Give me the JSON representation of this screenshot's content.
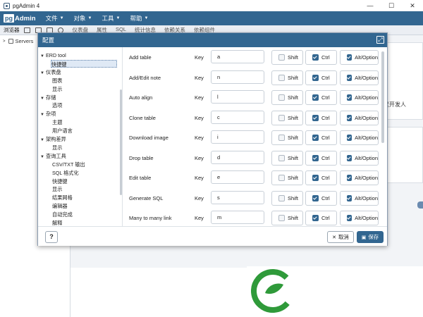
{
  "window": {
    "title": "pgAdmin 4",
    "controls": [
      "—",
      "☐",
      "✕"
    ]
  },
  "menubar": {
    "brand_pg": "pg",
    "brand_admin": "Admin",
    "items": [
      "文件",
      "对象",
      "工具",
      "帮助"
    ]
  },
  "toolbar": {
    "browser_label": "浏览器",
    "tabs": [
      "仪表盘",
      "属性",
      "SQL",
      "统计信息",
      "依赖关系",
      "依赖组件"
    ]
  },
  "tree_bg": {
    "servers_label": "Servers"
  },
  "background": {
    "partial_text": "满足开发人"
  },
  "dialog": {
    "title": "配置",
    "tree": [
      {
        "label": "ERD tool",
        "level": 0,
        "expanded": true
      },
      {
        "label": "快捷键",
        "level": 1,
        "selected": true
      },
      {
        "label": "仪表盘",
        "level": 0,
        "expanded": true
      },
      {
        "label": "图表",
        "level": 1
      },
      {
        "label": "显示",
        "level": 1
      },
      {
        "label": "存储",
        "level": 0,
        "expanded": true
      },
      {
        "label": "选项",
        "level": 1
      },
      {
        "label": "杂项",
        "level": 0,
        "expanded": true
      },
      {
        "label": "主题",
        "level": 1
      },
      {
        "label": "用户语言",
        "level": 1
      },
      {
        "label": "架构差异",
        "level": 0,
        "expanded": true
      },
      {
        "label": "显示",
        "level": 1
      },
      {
        "label": "查询工具",
        "level": 0,
        "expanded": true
      },
      {
        "label": "CSV/TXT 输出",
        "level": 1
      },
      {
        "label": "SQL 格式化",
        "level": 1
      },
      {
        "label": "快捷键",
        "level": 1
      },
      {
        "label": "显示",
        "level": 1
      },
      {
        "label": "结果网格",
        "level": 1
      },
      {
        "label": "编辑器",
        "level": 1
      },
      {
        "label": "自动完成",
        "level": 1
      },
      {
        "label": "解释",
        "level": 1
      }
    ],
    "key_label": "Key",
    "modifier_labels": {
      "shift": "Shift",
      "ctrl": "Ctrl",
      "alt": "Alt/Option"
    },
    "shortcuts": [
      {
        "name": "Add table",
        "key": "a",
        "shift": false,
        "ctrl": true,
        "alt": true
      },
      {
        "name": "Add/Edit note",
        "key": "n",
        "shift": false,
        "ctrl": true,
        "alt": true
      },
      {
        "name": "Auto align",
        "key": "l",
        "shift": false,
        "ctrl": true,
        "alt": true
      },
      {
        "name": "Clone table",
        "key": "c",
        "shift": false,
        "ctrl": true,
        "alt": true
      },
      {
        "name": "Download image",
        "key": "i",
        "shift": false,
        "ctrl": true,
        "alt": true
      },
      {
        "name": "Drop table",
        "key": "d",
        "shift": false,
        "ctrl": true,
        "alt": true
      },
      {
        "name": "Edit table",
        "key": "e",
        "shift": false,
        "ctrl": true,
        "alt": true
      },
      {
        "name": "Generate SQL",
        "key": "s",
        "shift": false,
        "ctrl": true,
        "alt": true
      },
      {
        "name": "Many to many link",
        "key": "m",
        "shift": false,
        "ctrl": true,
        "alt": true
      }
    ],
    "footer": {
      "help": "?",
      "cancel": "取消",
      "save": "保存"
    }
  },
  "colors": {
    "primary": "#326690",
    "watermark_green": "#2f9a3a"
  }
}
